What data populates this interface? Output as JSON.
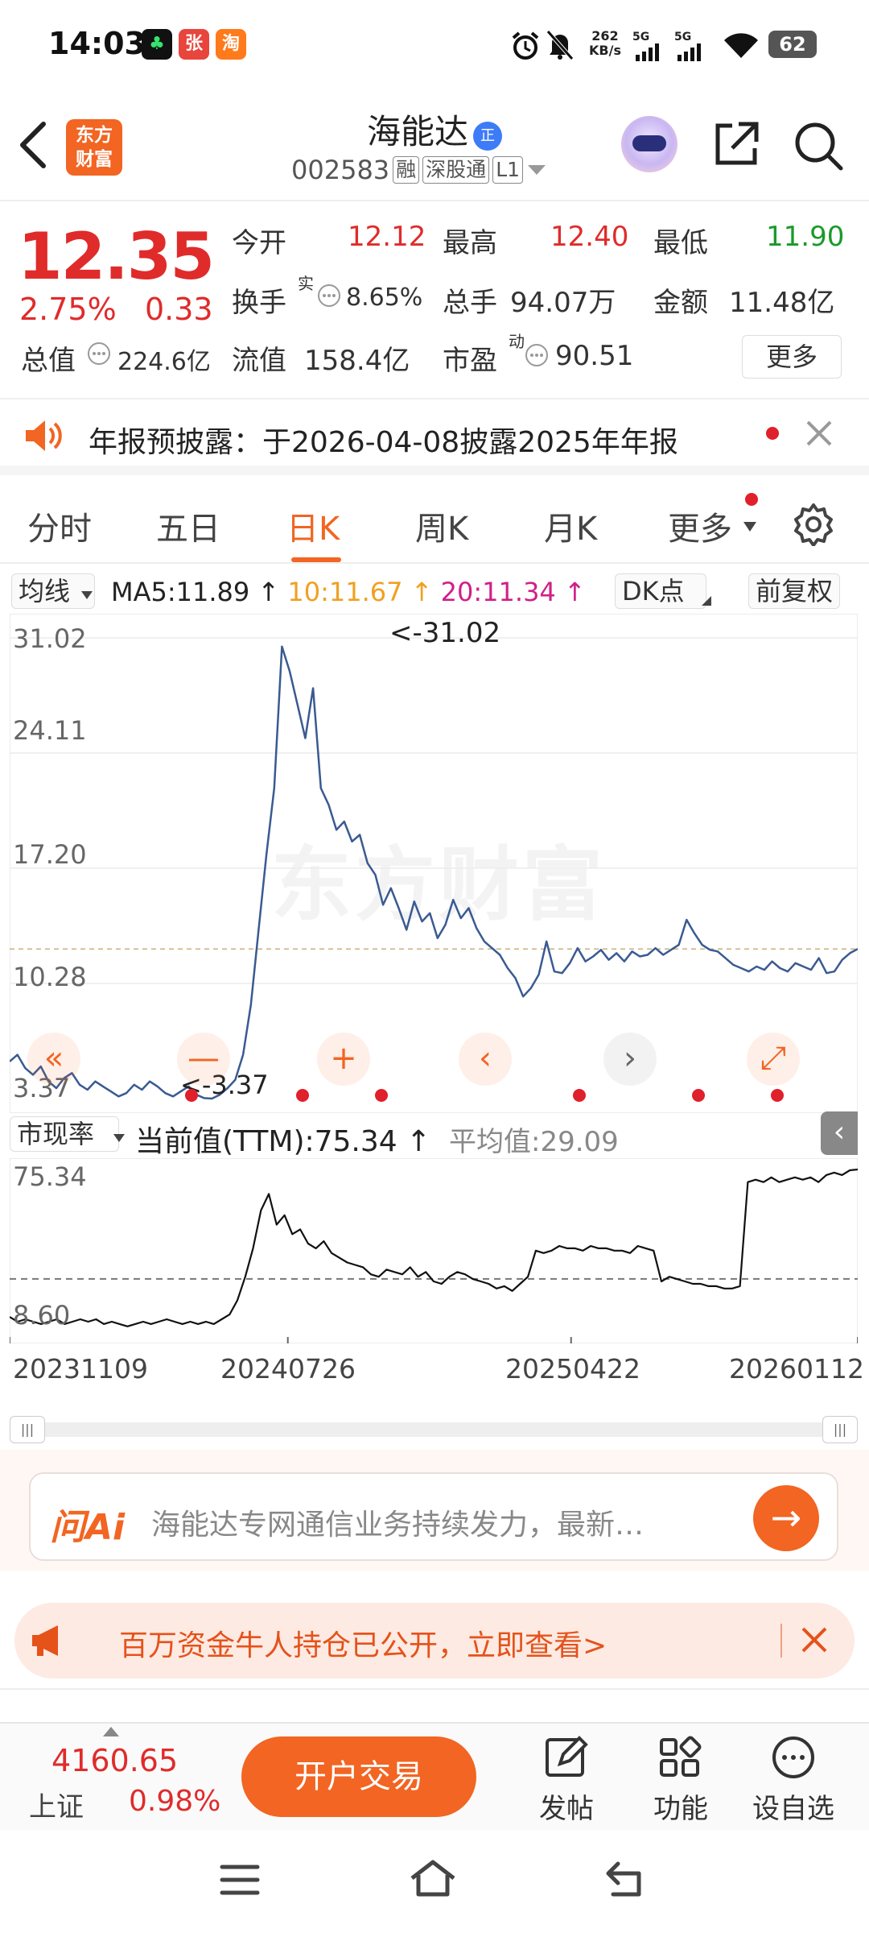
{
  "status_bar": {
    "time": "14:03",
    "net_speed_value": "262",
    "net_speed_unit": "KB/s",
    "signal1": "5G",
    "signal2": "5G",
    "battery": "62",
    "app_icons": [
      "grass-app-icon",
      "zhang-app-icon",
      "taobao-app-icon"
    ],
    "app_icon_labels": [
      "",
      "张",
      "淘"
    ]
  },
  "header": {
    "logo_line1": "东方",
    "logo_line2": "财富",
    "stock_name": "海能达",
    "badge": "正",
    "code": "002583",
    "tag1": "融",
    "tag2": "深股通",
    "tag3": "L1"
  },
  "quote": {
    "price": "12.35",
    "pct": "2.75%",
    "change": "0.33",
    "open_label": "今开",
    "open": "12.12",
    "high_label": "最高",
    "high": "12.40",
    "low_label": "最低",
    "low": "11.90",
    "turnover_label": "换手",
    "turnover_sup": "实",
    "turnover": "8.65%",
    "volume_label": "总手",
    "volume": "94.07万",
    "amount_label": "金额",
    "amount": "11.48亿",
    "mktcap_label": "总值",
    "mktcap": "224.6亿",
    "float_label": "流值",
    "float": "158.4亿",
    "pe_label": "市盈",
    "pe_sup": "动",
    "pe": "90.51",
    "more": "更多"
  },
  "notice": {
    "text": "年报预披露：于2026-04-08披露2025年年报"
  },
  "tabs": [
    "分时",
    "五日",
    "日K",
    "周K",
    "月K",
    "更多"
  ],
  "tabs_active": "日K",
  "chart_controls": {
    "ma_select": "均线",
    "ma5": "MA5:11.89 ↑",
    "ma10": "10:11.67 ↑",
    "ma20": "20:11.34 ↑",
    "dk": "DK点",
    "adjust": "前复权",
    "ma10_color": "#f0a020",
    "ma20_color": "#d0208a",
    "line_color": "#3a5a92"
  },
  "chart_data": [
    {
      "type": "line",
      "title": "",
      "y_ticks": [
        "31.02",
        "24.11",
        "17.20",
        "10.28",
        "3.37"
      ],
      "ylim": [
        3.37,
        31.02
      ],
      "max_annotation": "<-31.02",
      "min_annotation": "<-3.37",
      "reference_line": 12.35,
      "x_ticks": [
        "20231109",
        "20240726",
        "20250422",
        "20260112"
      ],
      "series": [
        {
          "values": [
            5.6,
            6.0,
            5.2,
            4.8,
            5.3,
            4.4,
            4.0,
            4.6,
            4.9,
            4.2,
            3.9,
            4.4,
            4.1,
            3.8,
            3.5,
            3.7,
            4.2,
            3.9,
            4.4,
            4.1,
            3.7,
            3.5,
            3.8,
            4.1,
            3.6,
            3.4,
            3.37,
            3.6,
            4.0,
            4.5,
            6.0,
            9.0,
            13.5,
            18.0,
            22.0,
            30.5,
            29.0,
            27.0,
            25.0,
            28.0,
            22.0,
            21.0,
            19.5,
            20.0,
            18.8,
            19.2,
            17.5,
            16.8,
            15.0,
            16.0,
            14.8,
            13.5,
            15.2,
            14.0,
            14.5,
            13.0,
            13.8,
            15.3,
            14.2,
            14.8,
            13.6,
            12.8,
            12.4,
            12.0,
            11.2,
            10.6,
            9.5,
            10.0,
            10.8,
            12.8,
            11.0,
            10.9,
            11.5,
            12.4,
            11.6,
            11.9,
            12.3,
            11.7,
            12.1,
            11.6,
            12.2,
            11.9,
            12.0,
            12.4,
            12.0,
            12.3,
            12.6,
            14.1,
            13.3,
            12.6,
            12.3,
            12.2,
            11.8,
            11.4,
            11.2,
            11.0,
            11.3,
            11.1,
            11.6,
            11.2,
            11.0,
            11.5,
            11.3,
            11.1,
            11.8,
            10.9,
            11.0,
            11.7,
            12.1,
            12.35
          ]
        }
      ]
    },
    {
      "type": "line",
      "title": "",
      "indicator": "市现率",
      "current_label": "当前值(TTM):75.34 ↑",
      "avg_label": "平均值:29.09",
      "y_ticks": [
        "75.34",
        "8.60"
      ],
      "ylim": [
        8.6,
        75.34
      ],
      "average": 29.09,
      "series": [
        {
          "values": [
            13,
            11,
            12,
            11,
            10,
            11,
            12,
            10,
            11,
            12,
            11,
            12,
            10,
            11,
            10,
            9,
            10,
            11,
            10,
            11,
            12,
            11,
            10,
            11,
            10,
            11,
            10,
            12,
            14,
            20,
            30,
            42,
            58,
            65,
            52,
            56,
            48,
            50,
            44,
            42,
            45,
            40,
            38,
            36,
            35,
            34,
            31,
            30,
            33,
            32,
            31,
            34,
            30,
            32,
            28,
            27,
            30,
            32,
            31,
            29,
            28,
            27,
            25,
            26,
            24,
            27,
            30,
            41,
            40,
            41,
            43,
            42,
            42,
            41,
            43,
            42,
            42,
            41,
            41,
            40,
            43,
            42,
            41,
            28,
            30,
            29,
            28,
            27,
            27,
            26,
            26,
            25,
            25,
            26,
            70,
            71,
            70,
            72,
            70,
            71,
            72,
            71,
            72,
            70,
            73,
            74,
            73,
            75,
            75.34
          ]
        }
      ]
    }
  ],
  "scrollbar": {
    "left": "|||",
    "right": "|||"
  },
  "ai": {
    "logo": "问Ai",
    "text": "海能达专网通信业务持续发力，最新…"
  },
  "banner": {
    "text": "百万资金牛人持仓已公开，立即查看>"
  },
  "toolbar": {
    "index_value": "4160.65",
    "index_name": "上证",
    "index_pct": "0.98%",
    "trade": "开户交易",
    "post": "发帖",
    "function": "功能",
    "watch": "设自选"
  },
  "colors": {
    "brand": "#f26522",
    "up": "#e02b2b",
    "down": "#1a9a2a"
  }
}
